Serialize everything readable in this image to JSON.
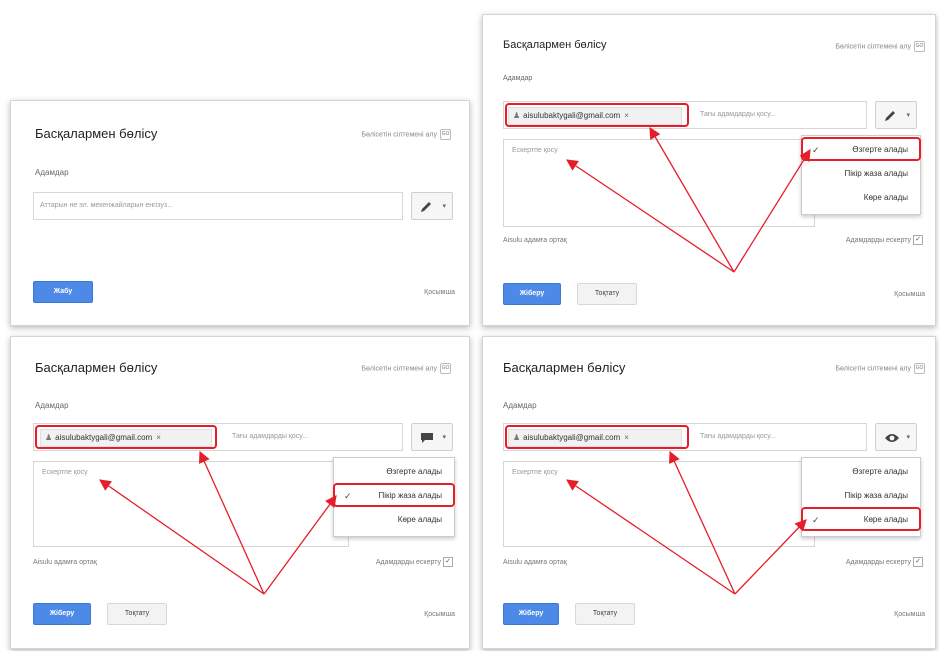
{
  "dialog": {
    "title": "Басқалармен бөлісу",
    "link_text": "Бөлісетін сілтемені алу",
    "people_label": "Адамдар",
    "placeholder_full": "Аттарын не эл. мекенжайларын енгізуз...",
    "add_more_placeholder": "Тағы адамдарды қосу...",
    "note_placeholder": "Ескертпе қосу",
    "email_chip": "aisulubaktygali@gmail.com",
    "send_copy": "Aisulu адамға ортақ",
    "notify_people": "Адамдарды ескерту",
    "done_label": "Жабу",
    "send_label": "Жіберу",
    "cancel_label": "Тоқтату",
    "advanced_label": "Қосымша"
  },
  "menu": {
    "items": [
      "Өзгерте алады",
      "Пікір жаза алады",
      "Көре алады"
    ]
  },
  "icons": {
    "permission_edit": "pencil-icon",
    "permission_comment": "comment-icon",
    "permission_view": "eye-icon"
  },
  "colors": {
    "highlight": "#e51e2a",
    "primary": "#4d8ae8"
  }
}
